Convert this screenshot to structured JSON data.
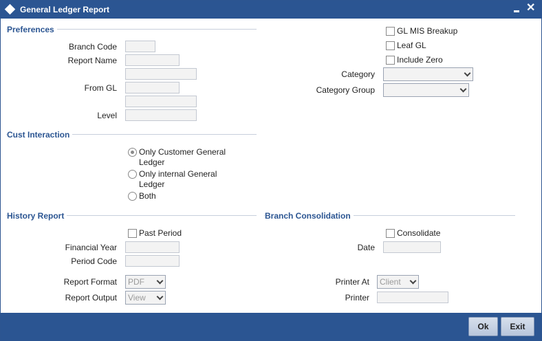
{
  "window": {
    "title": "General Ledger Report"
  },
  "preferences": {
    "title": "Preferences",
    "branch_code_label": "Branch Code",
    "report_name_label": "Report Name",
    "from_gl_label": "From GL",
    "level_label": "Level",
    "gl_mis_breakup_label": "GL MIS Breakup",
    "leaf_gl_label": "Leaf GL",
    "include_zero_label": "Include Zero",
    "category_label": "Category",
    "category_group_label": "Category Group"
  },
  "cust_interaction": {
    "title": "Cust Interaction",
    "options": [
      {
        "line1": "Only Customer General",
        "line2": "Ledger",
        "checked": true
      },
      {
        "line1": "Only internal General",
        "line2": "Ledger",
        "checked": false
      },
      {
        "line1": "Both",
        "line2": "",
        "checked": false
      }
    ]
  },
  "history_report": {
    "title": "History Report",
    "past_period_label": "Past Period",
    "financial_year_label": "Financial Year",
    "period_code_label": "Period Code"
  },
  "branch_consolidation": {
    "title": "Branch Consolidation",
    "consolidate_label": "Consolidate",
    "date_label": "Date"
  },
  "report": {
    "format_label": "Report Format",
    "format_value": "PDF",
    "output_label": "Report Output",
    "output_value": "View",
    "printer_at_label": "Printer At",
    "printer_at_value": "Client",
    "printer_label": "Printer"
  },
  "footer": {
    "ok_label": "Ok",
    "exit_label": "Exit"
  }
}
